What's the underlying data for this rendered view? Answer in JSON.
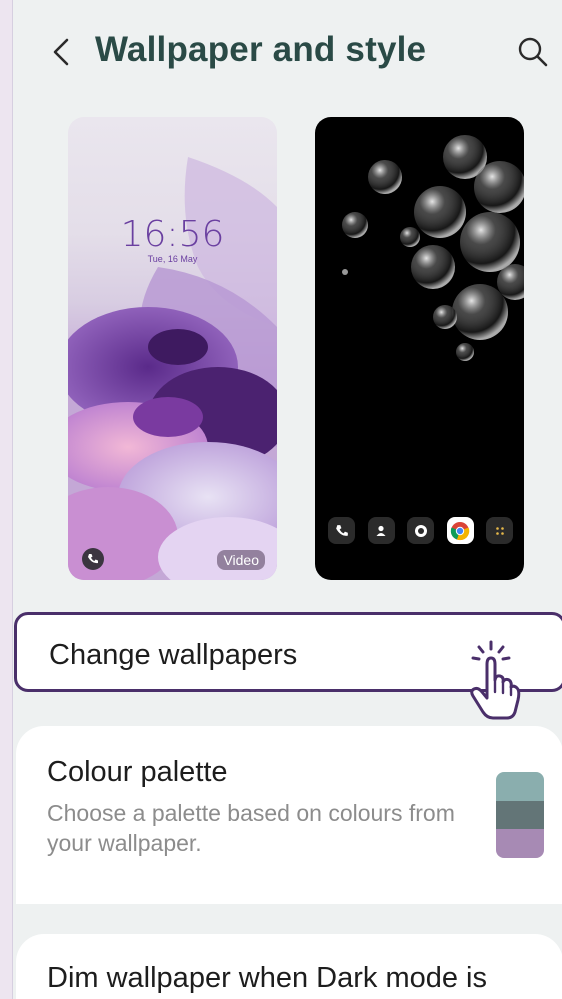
{
  "header": {
    "title": "Wallpaper and style",
    "back_icon": "chevron-left-icon",
    "search_icon": "search-icon"
  },
  "lock_preview": {
    "time": "16:56",
    "date": "Tue, 16 May",
    "badge": "Video"
  },
  "home_preview": {
    "dock_icons": [
      "phone-icon",
      "contacts-icon",
      "camera-icon",
      "chrome-icon",
      "apps-icon"
    ]
  },
  "change_wallpapers": {
    "label": "Change wallpapers"
  },
  "colour_palette": {
    "title": "Colour palette",
    "description": "Choose a palette based on colours from your wallpaper.",
    "swatch_colors": [
      "#8aaeae",
      "#637577",
      "#a78ab4"
    ]
  },
  "dim_wallpaper": {
    "title": "Dim wallpaper when Dark mode is"
  },
  "colors": {
    "title": "#2a4a46",
    "highlight_border": "#4a2f6a",
    "background": "#eef1f1"
  }
}
